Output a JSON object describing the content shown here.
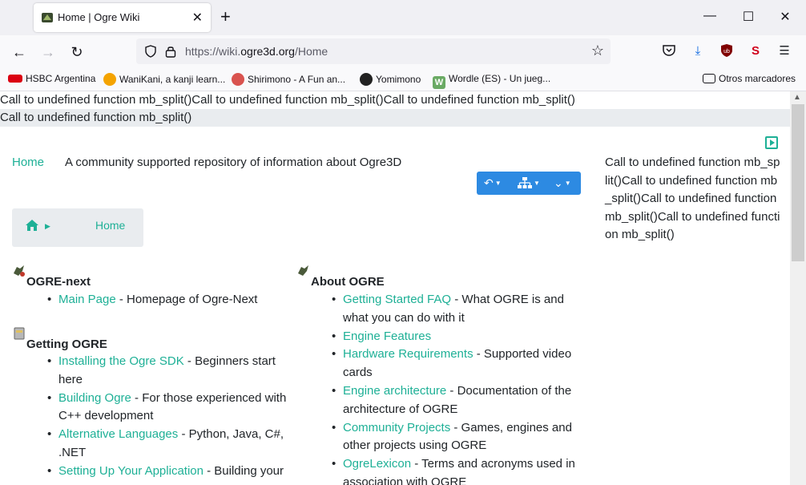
{
  "browser": {
    "tab_title": "Home | Ogre Wiki",
    "tab_close": "✕",
    "new_tab": "+",
    "window_controls": {
      "minimize": "—",
      "maximize": "☐",
      "close": "✕"
    },
    "url_prefix": "https://wiki.",
    "url_domain": "ogre3d.org",
    "url_path": "/Home",
    "bookmarks": [
      {
        "label": "HSBC Argentina",
        "icon": "hsbc-icon",
        "color": "#db0011"
      },
      {
        "label": "WaniKani, a kanji learn...",
        "icon": "wanikani-icon",
        "color": "#f4a300"
      },
      {
        "label": "Shirimono - A Fun an...",
        "icon": "shirimono-icon",
        "color": "#d9534f"
      },
      {
        "label": "Yomimono",
        "icon": "yomimono-icon",
        "color": "#222222"
      },
      {
        "label": "Wordle (ES) - Un jueg...",
        "icon": "wordle-icon",
        "color": "#6aaa64"
      }
    ],
    "other_bookmarks": "Otros marcadores"
  },
  "page": {
    "error_line_1": "Call to undefined function mb_split()Call to undefined function mb_split()Call to undefined function mb_split()",
    "error_line_2": "Call to undefined function mb_split()",
    "home_link": "Home",
    "tagline": "A community supported repository of information about Ogre3D",
    "side_text": "Call to undefined function mb_split()Call to undefined function mb_split()Call to undefined function mb_split()Call to undefined function mb_split()",
    "breadcrumb_current": "Home",
    "accent_color": "#1eb096",
    "action_color": "#2d8ae2"
  },
  "sections": {
    "ogre_next": {
      "title": "OGRE-next",
      "items": [
        {
          "link": "Main Page",
          "desc": " - Homepage of Ogre-Next"
        }
      ]
    },
    "getting_ogre": {
      "title": "Getting OGRE",
      "items": [
        {
          "link": "Installing the Ogre SDK",
          "desc": " - Beginners start here"
        },
        {
          "link": "Building Ogre",
          "desc": " - For those experienced with C++ development"
        },
        {
          "link": "Alternative Languages",
          "desc": " - Python, Java, C#, .NET"
        },
        {
          "link": "Setting Up Your Application",
          "desc": " - Building your"
        }
      ]
    },
    "about_ogre": {
      "title": "About OGRE",
      "items": [
        {
          "link": "Getting Started FAQ",
          "desc": " - What OGRE is and what you can do with it"
        },
        {
          "link": "Engine Features",
          "desc": ""
        },
        {
          "link": "Hardware Requirements",
          "desc": " - Supported video cards"
        },
        {
          "link": "Engine architecture",
          "desc": " - Documentation of the architecture of OGRE"
        },
        {
          "link": "Community Projects",
          "desc": " - Games, engines and other projects using OGRE"
        },
        {
          "link": "OgreLexicon",
          "desc": " - Terms and acronyms used in association with OGRE"
        }
      ]
    }
  }
}
